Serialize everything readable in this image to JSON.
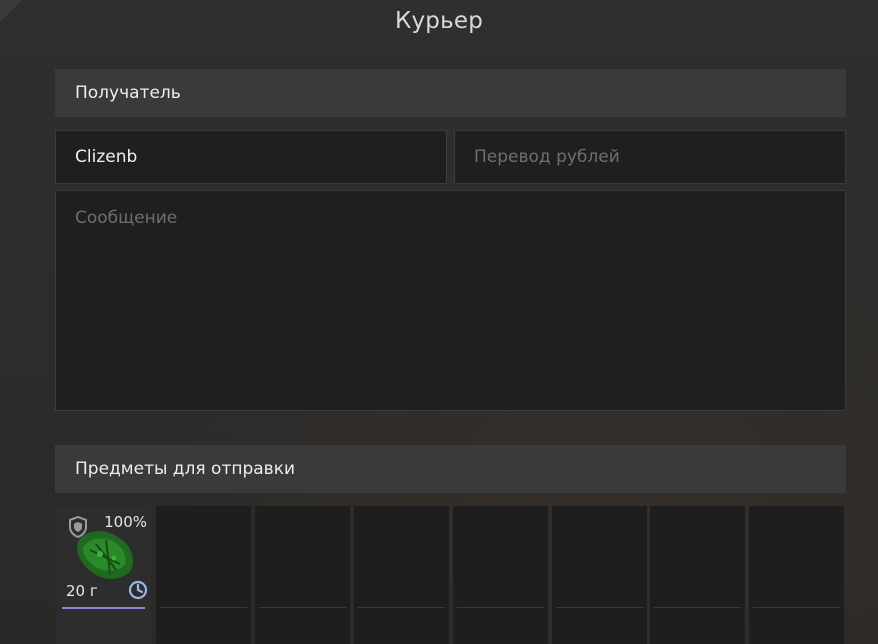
{
  "window": {
    "title": "Курьер"
  },
  "recipient": {
    "header": "Получатель",
    "name_value": "Clizenb",
    "transfer_placeholder": "Перевод рублей",
    "message_placeholder": "Сообщение"
  },
  "items": {
    "header": "Предметы для отправки",
    "slots": [
      {
        "durability": "100%",
        "weight": "20 г",
        "icons": [
          "shield-icon",
          "clock-icon"
        ],
        "art": "green-leafy-item"
      }
    ],
    "empty_slot_count_visible": 7
  },
  "colors": {
    "accent_underline": "#8a86d8",
    "header_bg": "#3a3a3a",
    "field_bg": "#1f1f1f"
  }
}
